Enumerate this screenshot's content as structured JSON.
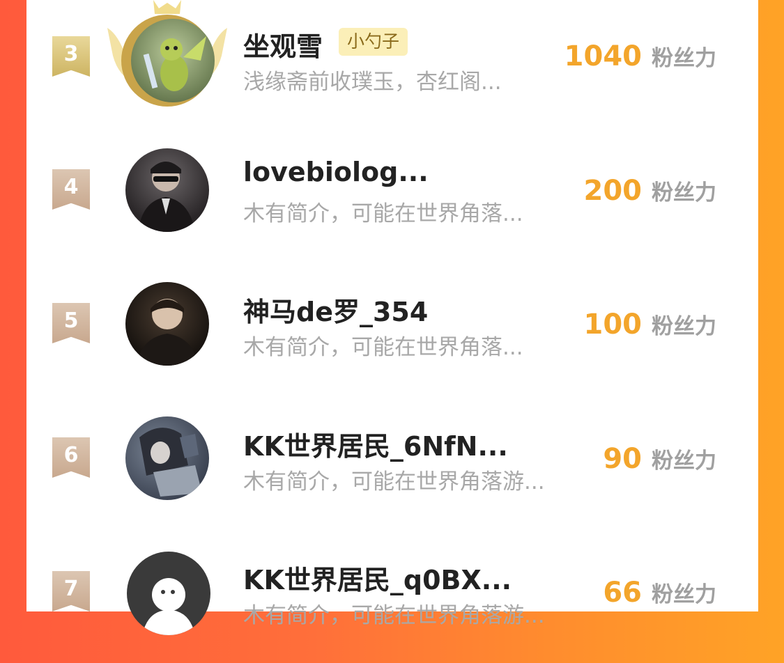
{
  "rows": [
    {
      "rank": "3",
      "name": "坐观雪",
      "tag": "小勺子",
      "desc": "浅缘斋前收璞玉，杏红阁...",
      "score": "1040",
      "unit": "粉丝力"
    },
    {
      "rank": "4",
      "name": "lovebiolog...",
      "desc": "木有简介，可能在世界角落...",
      "score": "200",
      "unit": "粉丝力"
    },
    {
      "rank": "5",
      "name": "神马de罗_354",
      "desc": "木有简介，可能在世界角落...",
      "score": "100",
      "unit": "粉丝力"
    },
    {
      "rank": "6",
      "name": "KK世界居民_6NfN...",
      "desc": "木有简介，可能在世界角落游...",
      "score": "90",
      "unit": "粉丝力"
    },
    {
      "rank": "7",
      "name": "KK世界居民_q0BX...",
      "desc": "木有简介，可能在世界角落游...",
      "score": "66",
      "unit": "粉丝力"
    }
  ],
  "colors": {
    "accent": "#f3a52b",
    "name": "#222222",
    "desc": "#a8a8a8",
    "rank_gold": "#cdb462",
    "rank_tan": "#c8a88e"
  }
}
